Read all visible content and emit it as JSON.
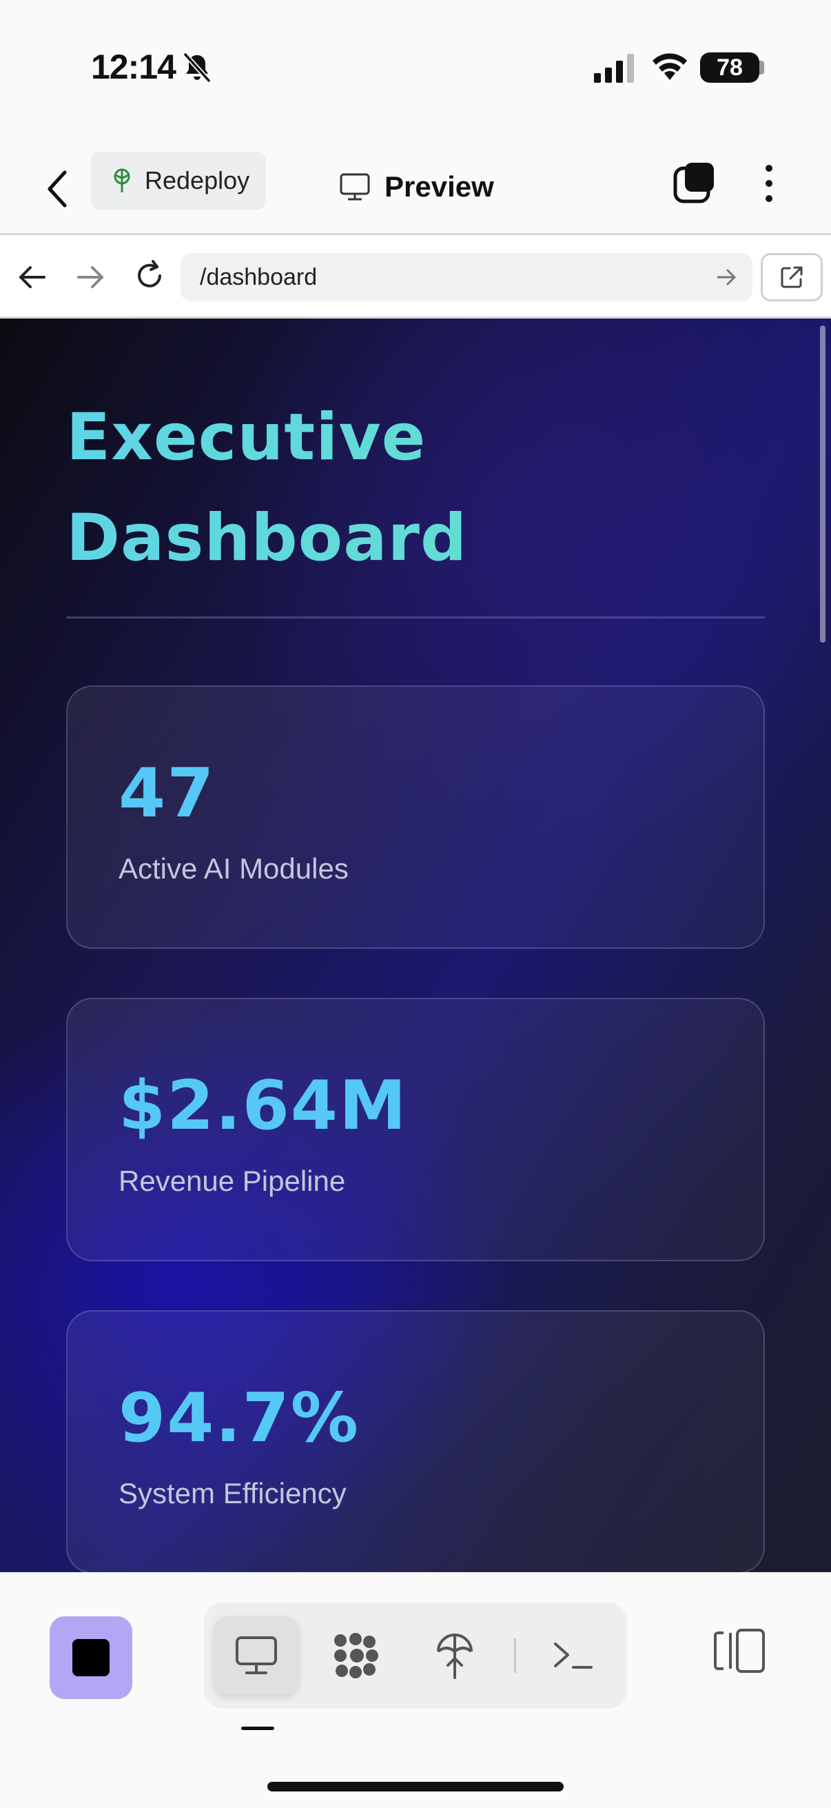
{
  "status_bar": {
    "time": "12:14",
    "battery": "78"
  },
  "header": {
    "redeploy_label": "Redeploy",
    "preview_label": "Preview"
  },
  "browser": {
    "url": "/dashboard"
  },
  "dashboard": {
    "title_line1": "Executive",
    "title_line2": "Dashboard",
    "cards": [
      {
        "value": "47",
        "label": "Active AI Modules"
      },
      {
        "value": "$2.64M",
        "label": "Revenue Pipeline"
      },
      {
        "value": "94.7%",
        "label": "System Efficiency"
      }
    ]
  },
  "toolbar": {
    "icons": [
      "stop-icon",
      "desktop-icon",
      "grid-dots-icon",
      "deploy-icon",
      "terminal-icon",
      "panel-icon"
    ]
  },
  "colors": {
    "accent_purple": "#b3a6f5",
    "metric_blue": "#56c8f5",
    "title_teal": "#64e2c8"
  }
}
